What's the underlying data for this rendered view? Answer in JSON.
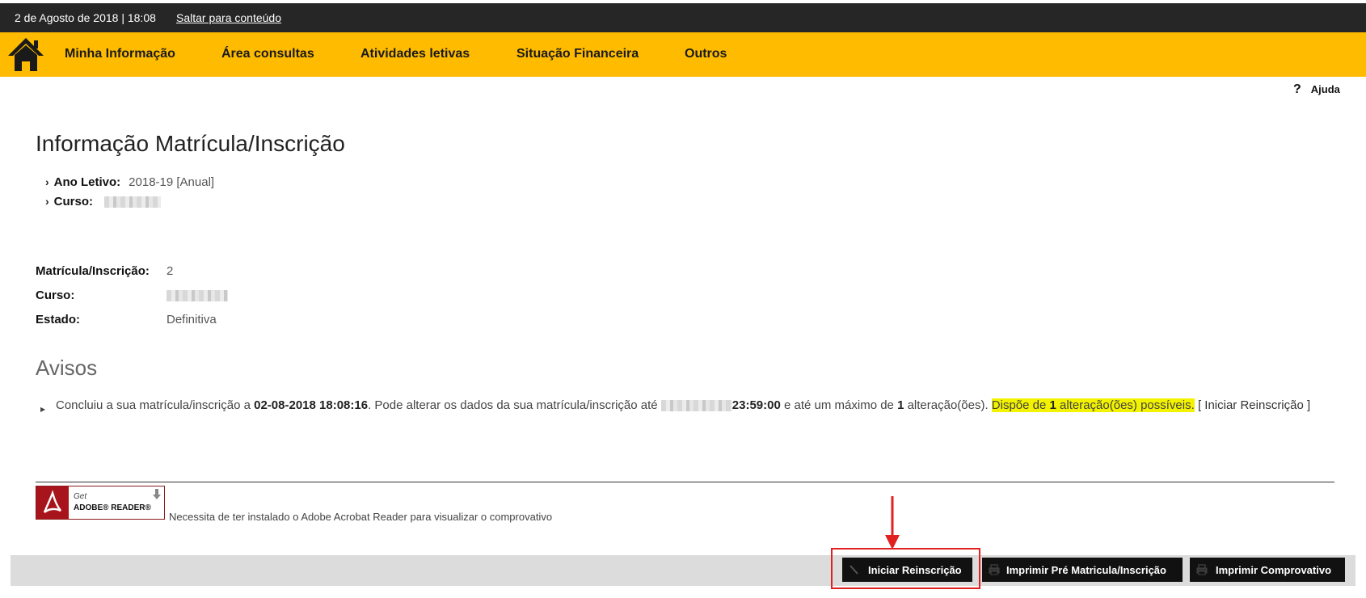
{
  "topbar": {
    "datetime": "2 de Agosto de 2018 | 18:08",
    "skip_link": "Saltar para conteúdo"
  },
  "nav": {
    "home_icon": "home-icon",
    "items": [
      {
        "label": "Minha Informação"
      },
      {
        "label": "Área consultas"
      },
      {
        "label": "Atividades letivas"
      },
      {
        "label": "Situação Financeira"
      },
      {
        "label": "Outros"
      }
    ]
  },
  "help": {
    "label": "Ajuda",
    "icon": "question-icon"
  },
  "page": {
    "title": "Informação Matrícula/Inscrição",
    "ano_letivo_label": "Ano Letivo:",
    "ano_letivo_value": "2018-19 [Anual]",
    "curso_label": "Curso:"
  },
  "matricula": {
    "num_label": "Matrícula/Inscrição:",
    "num_value": "2",
    "curso_label": "Curso:",
    "estado_label": "Estado:",
    "estado_value": "Definitiva"
  },
  "avisos": {
    "title": "Avisos",
    "t1": "Concluiu a sua matrícula/inscrição a ",
    "date_done": "02-08-2018 18:08:16",
    "t2": ". Pode alterar os dados da sua matrícula/inscrição até ",
    "time_limit": "23:59:00",
    "t3": " e até um máximo de ",
    "max_changes": "1",
    "t4": " alteração(ões). ",
    "hl_a": "Dispõe de ",
    "hl_num": "1",
    "hl_b": " alteração(ões) possíveis.",
    "link_text": " [ Iniciar Reinscrição ]"
  },
  "adobe": {
    "get": "Get",
    "name": "ADOBE® READER®",
    "note": "Necessita de ter instalado o Adobe Acrobat Reader para visualizar o comprovativo"
  },
  "buttons": {
    "iniciar": "Iniciar Reinscrição",
    "pre": "Imprimir Pré Matricula/Inscrição",
    "comprovativo": "Imprimir Comprovativo"
  },
  "colors": {
    "nav_bg": "#ffbb00",
    "topbar_bg": "#262626",
    "highlight": "#f3f300",
    "annotation": "#e12020"
  }
}
